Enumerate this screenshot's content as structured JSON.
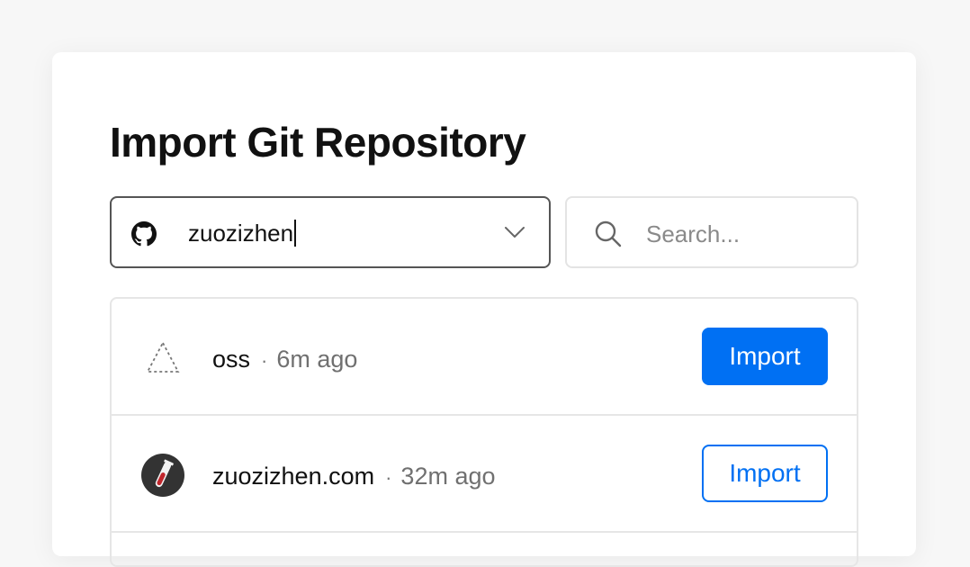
{
  "page": {
    "title": "Import Git Repository"
  },
  "account_select": {
    "provider_icon": "github-icon",
    "value": "zuozizhen",
    "chevron_icon": "chevron-down-icon"
  },
  "search": {
    "icon": "search-icon",
    "placeholder": "Search...",
    "value": ""
  },
  "repos": [
    {
      "icon": "triangle-outline-icon",
      "name": "oss",
      "separator": "·",
      "updated": "6m ago",
      "import_label": "Import",
      "button_style": "primary"
    },
    {
      "icon": "test-tube-icon",
      "name": "zuozizhen.com",
      "separator": "·",
      "updated": "32m ago",
      "import_label": "Import",
      "button_style": "secondary"
    }
  ],
  "colors": {
    "accent": "#0070f3",
    "border": "#e6e6e6",
    "muted_text": "#707070"
  }
}
